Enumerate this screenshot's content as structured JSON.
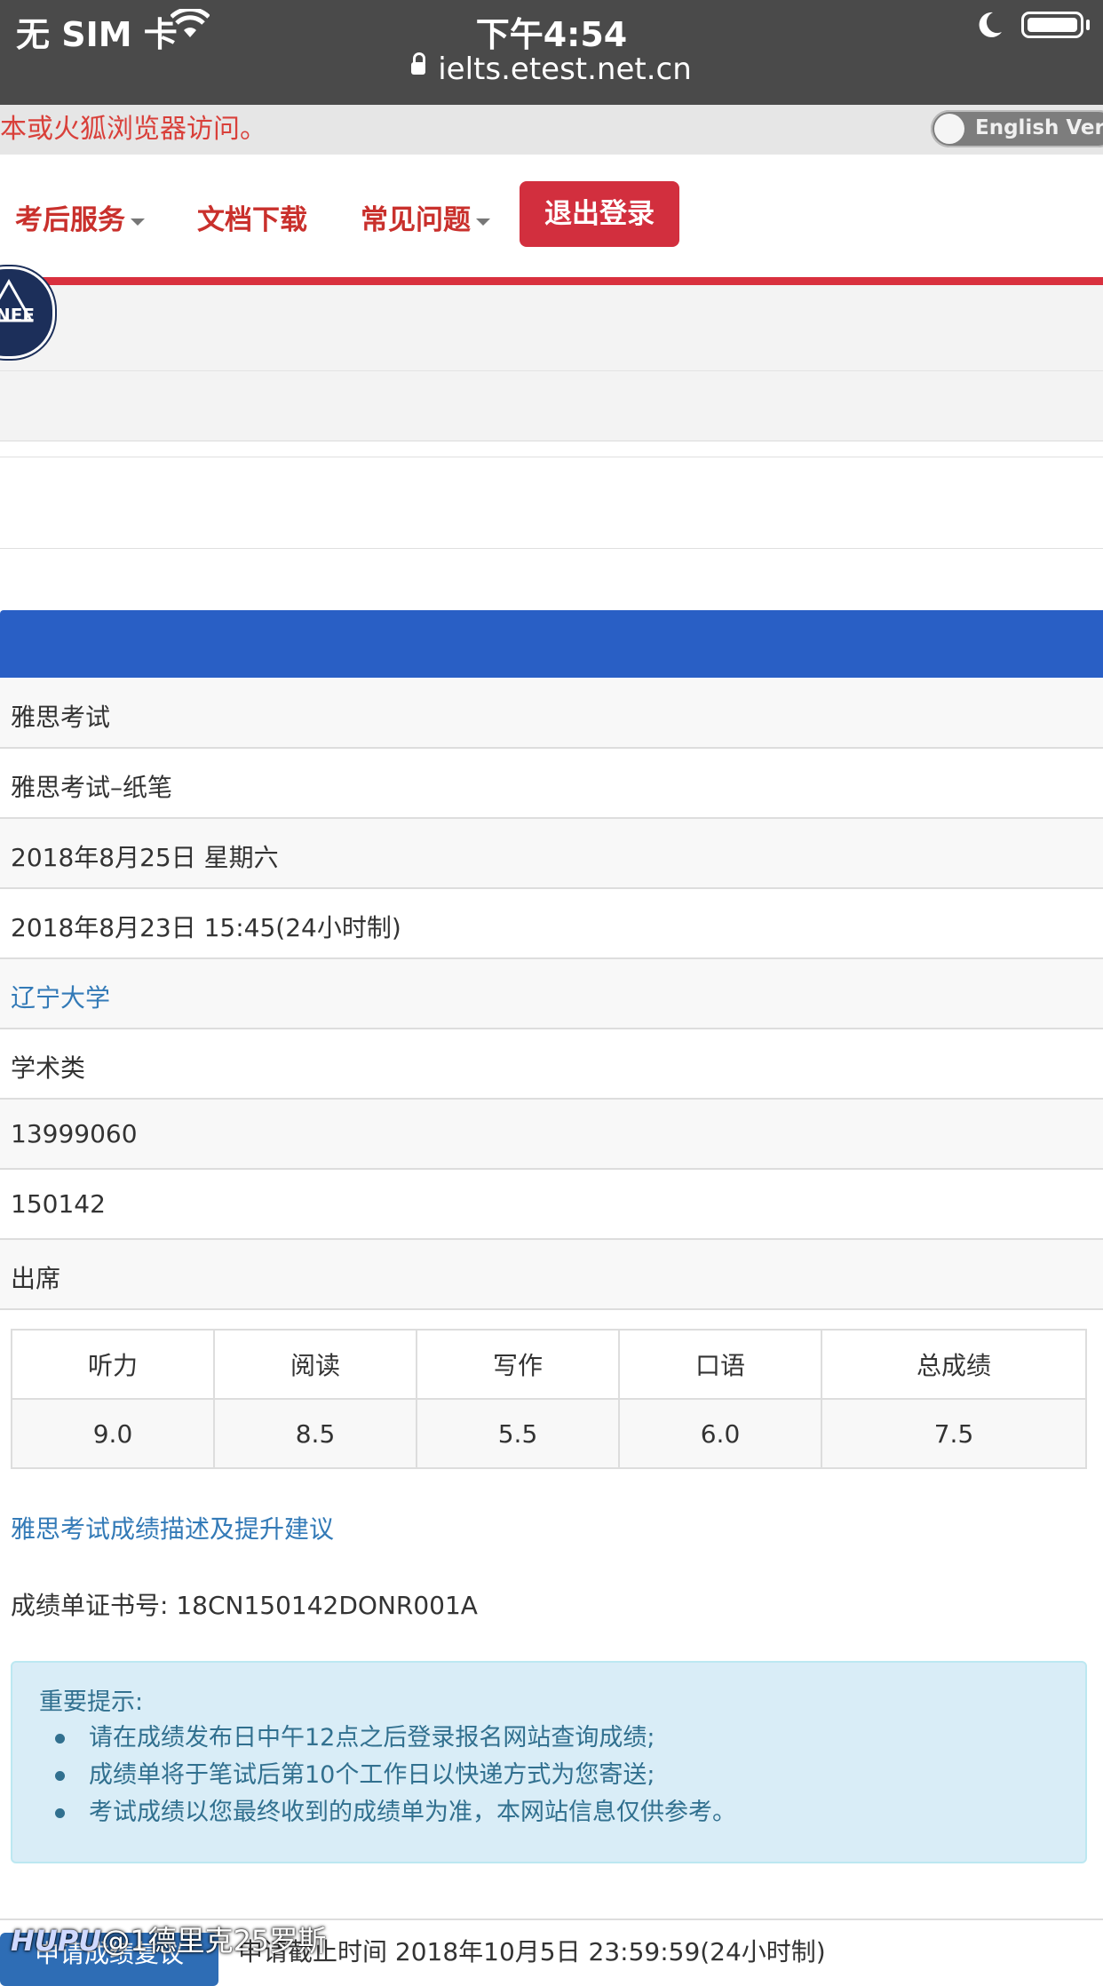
{
  "status_bar": {
    "carrier": "无 SIM 卡",
    "time": "下午4:54",
    "url": "ielts.etest.net.cn"
  },
  "notice": {
    "text": "本或火狐浏览器访问。",
    "lang_toggle": "English Version"
  },
  "nav": {
    "items": [
      "考后服务",
      "文档下载",
      "常见问题"
    ],
    "logout": "退出登录"
  },
  "logo": {
    "text": "NEE"
  },
  "info_rows": [
    "雅思考试",
    "雅思考试–纸笔",
    "2018年8月25日 星期六",
    "2018年8月23日 15:45(24小时制)",
    "辽宁大学",
    "学术类",
    "13999060",
    "150142",
    "出席"
  ],
  "scores": {
    "headers": [
      "听力",
      "阅读",
      "写作",
      "口语",
      "总成绩"
    ],
    "values": [
      "9.0",
      "8.5",
      "5.5",
      "6.0",
      "7.5"
    ]
  },
  "suggest_link": "雅思考试成绩描述及提升建议",
  "certificate": "成绩单证书号: 18CN150142DONR001A",
  "alert": {
    "title": "重要提示:",
    "items": [
      "请在成绩发布日中午12点之后登录报名网站查询成绩;",
      "成绩单将于笔试后第10个工作日以快递方式为您寄送;",
      "考试成绩以您最终收到的成绩单为准，本网站信息仅供参考。"
    ]
  },
  "bottom": {
    "apply_button": "申请成绩复议",
    "deadline": "申请截止时间 2018年10月5日 23:59:59(24小时制)"
  },
  "watermark": {
    "brand": "HUPU",
    "text": "@1德里克25罗斯"
  },
  "colors": {
    "nav_red": "#c9302c",
    "logout_bg": "#d22f3e",
    "blue_header": "#295fc5",
    "link_blue": "#337ab7",
    "alert_bg": "#d9edf7"
  }
}
